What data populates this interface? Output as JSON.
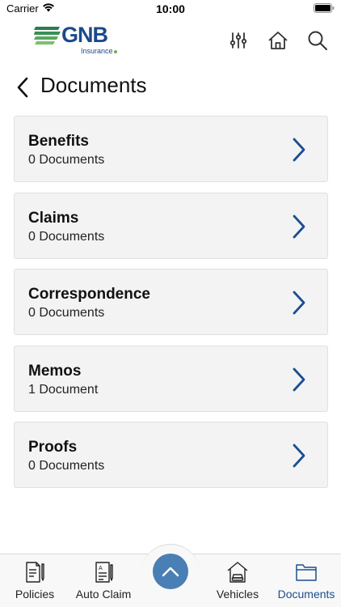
{
  "status": {
    "carrier": "Carrier",
    "time": "10:00"
  },
  "header": {
    "logo_text": "GNB",
    "logo_sub": "Insurance",
    "brand_color": "#1a4a8a"
  },
  "page": {
    "title": "Documents"
  },
  "documents": [
    {
      "name": "Benefits",
      "count": "0 Documents"
    },
    {
      "name": "Claims",
      "count": "0 Documents"
    },
    {
      "name": "Correspondence",
      "count": "0 Documents"
    },
    {
      "name": "Memos",
      "count": "1 Document"
    },
    {
      "name": "Proofs",
      "count": "0 Documents"
    }
  ],
  "tabs": [
    {
      "label": "Policies",
      "icon": "policies-icon",
      "active": false
    },
    {
      "label": "Auto Claim",
      "icon": "auto-claim-icon",
      "active": false
    },
    {
      "label": "Vehicles",
      "icon": "vehicles-icon",
      "active": false
    },
    {
      "label": "Documents",
      "icon": "folder-icon",
      "active": true
    }
  ],
  "colors": {
    "accent": "#1b4f8f",
    "center_button": "#4a7fb5",
    "card_bg": "#f3f3f4"
  }
}
